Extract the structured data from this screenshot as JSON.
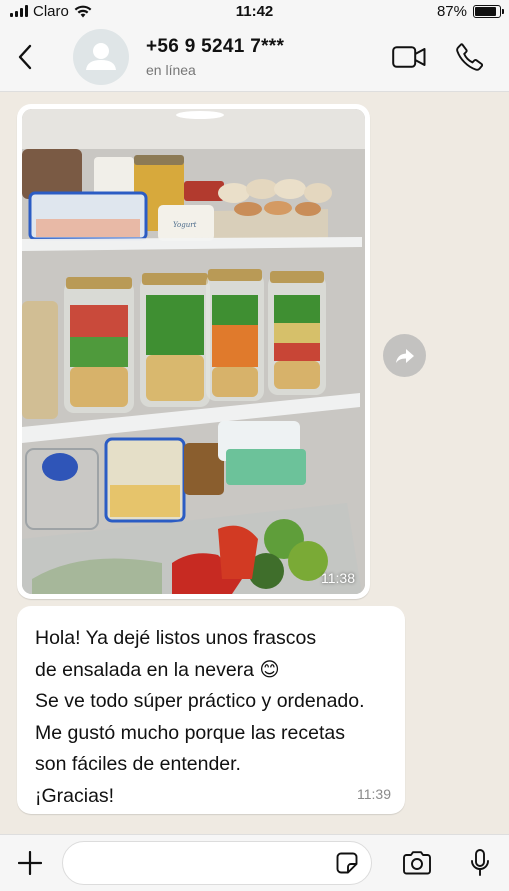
{
  "status_bar": {
    "carrier": "Claro",
    "time": "11:42",
    "battery": "87%",
    "battery_level": 0.87
  },
  "header": {
    "contact_name": "+56 9 5241 7***",
    "contact_status": "en línea",
    "icons": {
      "back": "chevron-left-icon",
      "video": "video-camera-icon",
      "call": "phone-icon"
    }
  },
  "messages": [
    {
      "type": "image",
      "time": "11:38",
      "image_label": "Yogurt"
    },
    {
      "type": "text",
      "lines": [
        "Hola! Ya dejé listos unos frascos",
        "de ensalada en la nevera 😊",
        "Se ve todo súper práctico y ordenado.",
        "Me gustó mucho porque las recetas",
        "son fáciles de entender.",
        "¡Gracias!"
      ],
      "time": "11:39"
    }
  ],
  "input_bar": {
    "placeholder": "",
    "icons": {
      "attach": "plus-icon",
      "sticker": "sticker-icon",
      "camera": "camera-icon",
      "mic": "microphone-icon"
    }
  },
  "colors": {
    "background": "#efeae2",
    "bubble": "#ffffff",
    "bar": "#f6f6f6"
  }
}
